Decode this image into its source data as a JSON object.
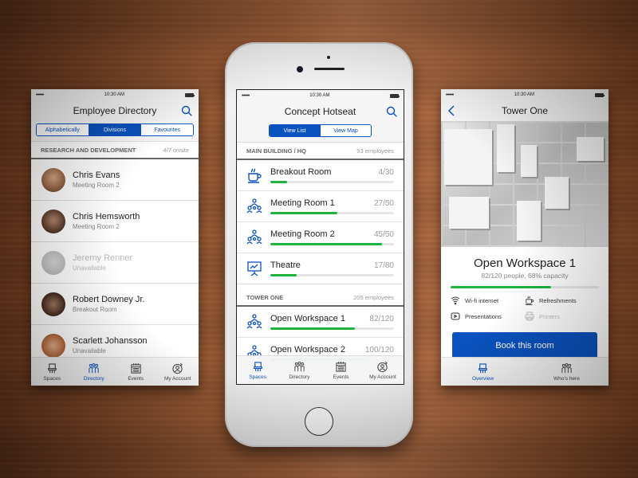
{
  "theme": {
    "accent": "#0a52be",
    "progress": "#1db33d",
    "track": "#e6e6e6"
  },
  "status": {
    "time": "10:30 AM",
    "signal": "•••••"
  },
  "directory_screen": {
    "title": "Employee Directory",
    "segments": [
      {
        "label": "Alphabetically",
        "active": false
      },
      {
        "label": "Divisions",
        "active": true
      },
      {
        "label": "Favourites",
        "active": false
      }
    ],
    "section": {
      "title": "RESEARCH AND DEVELOPMENT",
      "count": "4/7 onsite"
    },
    "people": [
      {
        "name": "Chris Evans",
        "location": "Meeting Room 2",
        "available": true,
        "avatar_color": "#b07a5a"
      },
      {
        "name": "Chris Hemsworth",
        "location": "Meeting Room 2",
        "available": true,
        "avatar_color": "#6b4e3e"
      },
      {
        "name": "Jeremy Renner",
        "location": "Unavailable",
        "available": false,
        "avatar_color": "#8a8a8a"
      },
      {
        "name": "Robert Downey Jr.",
        "location": "Breakout Room",
        "available": true,
        "avatar_color": "#5a3a2a"
      },
      {
        "name": "Scarlett Johansson",
        "location": "Unavailable",
        "available": true,
        "avatar_color": "#c48a5a"
      }
    ],
    "tabs": [
      {
        "label": "Spaces",
        "icon": "chair-icon"
      },
      {
        "label": "Directory",
        "icon": "people-icon",
        "active": true
      },
      {
        "label": "Events",
        "icon": "calendar-icon"
      },
      {
        "label": "My Account",
        "icon": "account-icon"
      }
    ]
  },
  "hotseat_screen": {
    "title": "Concept Hotseat",
    "segments": [
      {
        "label": "View List",
        "active": true
      },
      {
        "label": "View Map",
        "active": false
      }
    ],
    "sections": [
      {
        "title": "MAIN BUILDING / HQ",
        "count": "93 employees",
        "rooms": [
          {
            "name": "Breakout Room",
            "count": "4/30",
            "fill": 0.133,
            "icon": "coffee-cup-icon"
          },
          {
            "name": "Meeting Room 1",
            "count": "27/50",
            "fill": 0.54,
            "icon": "meeting-group-icon"
          },
          {
            "name": "Meeting Room 2",
            "count": "45/50",
            "fill": 0.9,
            "icon": "meeting-group-icon"
          },
          {
            "name": "Theatre",
            "count": "17/80",
            "fill": 0.2125,
            "icon": "presentation-board-icon"
          }
        ]
      },
      {
        "title": "TOWER ONE",
        "count": "205 employees",
        "rooms": [
          {
            "name": "Open Workspace 1",
            "count": "82/120",
            "fill": 0.683,
            "icon": "meeting-group-icon"
          },
          {
            "name": "Open Workspace 2",
            "count": "100/120",
            "fill": 0.8,
            "icon": "meeting-group-icon"
          }
        ]
      }
    ],
    "tabs": [
      {
        "label": "Spaces",
        "icon": "chair-icon",
        "active": true
      },
      {
        "label": "Directory",
        "icon": "people-icon"
      },
      {
        "label": "Events",
        "icon": "calendar-icon"
      },
      {
        "label": "My Account",
        "icon": "account-icon"
      }
    ]
  },
  "room_screen": {
    "title": "Tower One",
    "room_name": "Open Workspace 1",
    "capacity_text": "82/120 people, 68% capacity",
    "capacity_fill": 0.68,
    "amenities": [
      {
        "label": "Wi-fi internet",
        "icon": "wifi-icon",
        "available": true
      },
      {
        "label": "Refreshments",
        "icon": "coffee-cup-icon",
        "available": true
      },
      {
        "label": "Presentations",
        "icon": "play-icon",
        "available": true
      },
      {
        "label": "Printers",
        "icon": "printer-icon",
        "available": false
      }
    ],
    "book_label": "Book this room",
    "tabs": [
      {
        "label": "Overview",
        "icon": "chair-icon",
        "active": true
      },
      {
        "label": "Who's here",
        "icon": "people-icon"
      }
    ]
  }
}
